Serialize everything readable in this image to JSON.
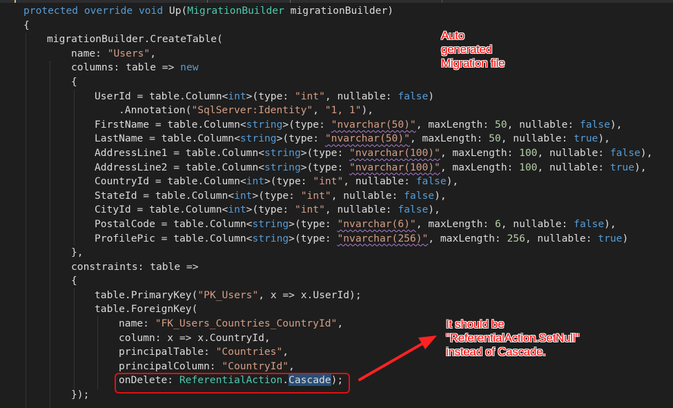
{
  "code": {
    "signature": {
      "protected": "protected",
      "override": "override",
      "void": "void",
      "method": "Up(",
      "param_type": "MigrationBuilder",
      "param_name": " migrationBuilder)"
    },
    "open_brace": "{",
    "create_table": "migrationBuilder.CreateTable(",
    "name_label": "name: ",
    "table_name": "\"Users\"",
    "columns_label": "columns: table => ",
    "new_kw": "new",
    "columns_open": "{",
    "columns": [
      {
        "name": "UserId = table.Column<",
        "type": "int",
        "mid": ">(type: ",
        "dbtype": "\"int\"",
        "rest1": ", nullable: ",
        "nullable": "false",
        "end": ")"
      },
      {
        "name": "FirstName = table.Column<",
        "type": "string",
        "mid": ">(type: ",
        "dbtype": "\"nvarchar(50)\"",
        "maxlen_label": ", maxLength: ",
        "maxlen": "50",
        "rest1": ", nullable: ",
        "nullable": "false",
        "end": "),"
      },
      {
        "name": "LastName = table.Column<",
        "type": "string",
        "mid": ">(type: ",
        "dbtype": "\"nvarchar(50)\"",
        "maxlen_label": ", maxLength: ",
        "maxlen": "50",
        "rest1": ", nullable: ",
        "nullable": "true",
        "end": "),"
      },
      {
        "name": "AddressLine1 = table.Column<",
        "type": "string",
        "mid": ">(type: ",
        "dbtype": "\"nvarchar(100)\"",
        "maxlen_label": ", maxLength: ",
        "maxlen": "100",
        "rest1": ", nullable: ",
        "nullable": "false",
        "end": "),"
      },
      {
        "name": "AddressLine2 = table.Column<",
        "type": "string",
        "mid": ">(type: ",
        "dbtype": "\"nvarchar(100)\"",
        "maxlen_label": ", maxLength: ",
        "maxlen": "100",
        "rest1": ", nullable: ",
        "nullable": "true",
        "end": "),"
      },
      {
        "name": "CountryId = table.Column<",
        "type": "int",
        "mid": ">(type: ",
        "dbtype": "\"int\"",
        "rest1": ", nullable: ",
        "nullable": "false",
        "end": "),"
      },
      {
        "name": "StateId = table.Column<",
        "type": "int",
        "mid": ">(type: ",
        "dbtype": "\"int\"",
        "rest1": ", nullable: ",
        "nullable": "false",
        "end": "),"
      },
      {
        "name": "CityId = table.Column<",
        "type": "int",
        "mid": ">(type: ",
        "dbtype": "\"int\"",
        "rest1": ", nullable: ",
        "nullable": "false",
        "end": "),"
      },
      {
        "name": "PostalCode = table.Column<",
        "type": "string",
        "mid": ">(type: ",
        "dbtype": "\"nvarchar(6)\"",
        "maxlen_label": ", maxLength: ",
        "maxlen": "6",
        "rest1": ", nullable: ",
        "nullable": "false",
        "end": "),"
      },
      {
        "name": "ProfilePic = table.Column<",
        "type": "string",
        "mid": ">(type: ",
        "dbtype": "\"nvarchar(256)\"",
        "maxlen_label": ", maxLength: ",
        "maxlen": "256",
        "rest1": ", nullable: ",
        "nullable": "true",
        "end": ")"
      }
    ],
    "annotation_pre": ".Annotation(",
    "annotation_key": "\"SqlServer:Identity\"",
    "annotation_sep": ", ",
    "annotation_val": "\"1, 1\"",
    "annotation_end": "),",
    "columns_close": "},",
    "constraints_label": "constraints: table =>",
    "constraints_open": "{",
    "pk_pre": "table.PrimaryKey(",
    "pk_name": "\"PK_Users\"",
    "pk_rest": ", x => x.UserId);",
    "fk_pre": "table.ForeignKey(",
    "fk_name_label": "name: ",
    "fk_name": "\"FK_Users_Countries_CountryId\"",
    "fk_name_end": ",",
    "fk_column": "column: x => x.CountryId,",
    "fk_ptable_label": "principalTable: ",
    "fk_ptable": "\"Countries\"",
    "fk_ptable_end": ",",
    "fk_pcol_label": "principalColumn: ",
    "fk_pcol": "\"CountryId\"",
    "fk_pcol_end": ",",
    "ondelete_label": "onDelete: ",
    "ondelete_type": "ReferentialAction",
    "ondelete_dot": ".",
    "ondelete_value": "Cascade",
    "ondelete_end": ");",
    "close": "});"
  },
  "annotations": {
    "top_note": [
      "Auto",
      "generated",
      "Migration file"
    ],
    "bottom_note": [
      "It should be",
      "\"ReferentialAction.SetNull\"",
      "instead of Cascade."
    ]
  },
  "colors": {
    "background": "#1e1e1e",
    "keyword": "#569cd6",
    "type": "#4ec9b0",
    "string": "#d69d85",
    "number": "#b5cea8",
    "annotation": "#ff0000"
  }
}
